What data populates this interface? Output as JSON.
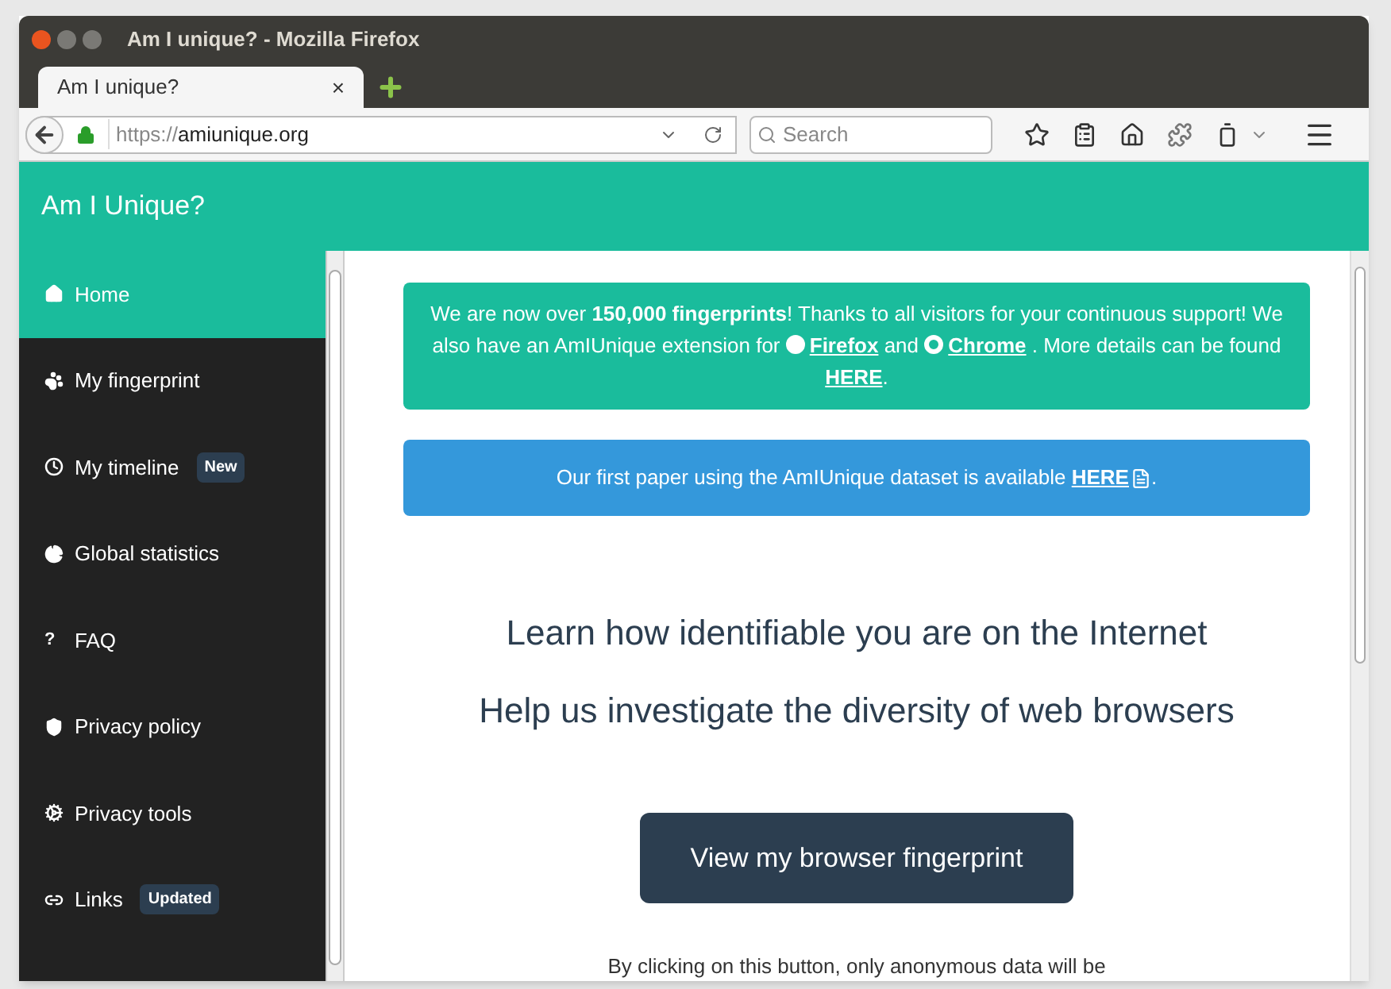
{
  "window": {
    "title": "Am I unique? - Mozilla Firefox"
  },
  "tabs": [
    {
      "label": "Am I unique?",
      "selected": true,
      "close": "×"
    }
  ],
  "address_bar": {
    "value_prefix": "https://",
    "value_host": "amiunique.org"
  },
  "search": {
    "placeholder": "Search"
  },
  "site": {
    "title": "Am I Unique?"
  },
  "sidebar": {
    "items": [
      {
        "label": "Home",
        "selected": true
      },
      {
        "label": "My fingerprint",
        "selected": false
      },
      {
        "label": "My timeline",
        "selected": false,
        "badge": "New"
      },
      {
        "label": "Global statistics",
        "selected": false
      },
      {
        "label": "FAQ",
        "selected": false,
        "glyph": "?"
      },
      {
        "label": "Privacy policy",
        "selected": false
      },
      {
        "label": "Privacy tools",
        "selected": false
      },
      {
        "label": "Links",
        "selected": false,
        "badge": "Updated"
      }
    ]
  },
  "notices": [
    {
      "kind": "success",
      "parts": [
        {
          "kind": "text",
          "text": "We are now over **150,000 fingerprints**! Thanks to all visitors for your continuous support! We also have an AmIUnique extension for "
        },
        {
          "kind": "icon-link",
          "text": "Firefox"
        },
        {
          "kind": "text",
          "text": " and "
        },
        {
          "kind": "icon-link",
          "text": "Chrome"
        },
        {
          "kind": "text",
          "text": " . More details can be found "
        },
        {
          "kind": "link",
          "text": "HERE"
        },
        {
          "kind": "text",
          "text": "."
        }
      ]
    },
    {
      "kind": "info",
      "parts": [
        {
          "kind": "text",
          "text": "Our first paper using the AmIUnique dataset is available "
        },
        {
          "kind": "pdf-link",
          "text": "HERE"
        },
        {
          "kind": "text",
          "text": "."
        }
      ]
    }
  ],
  "headings": [
    "Learn how identifiable you are on the Internet",
    "Help us investigate the diversity of web browsers"
  ],
  "cta_button": "View my browser fingerprint",
  "footnote": "By clicking on this button, only anonymous data will be"
}
